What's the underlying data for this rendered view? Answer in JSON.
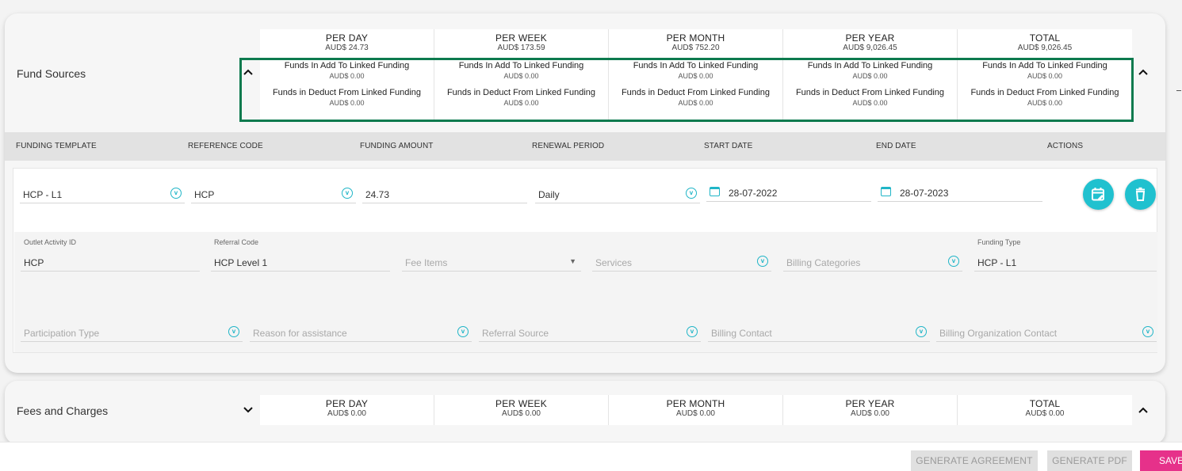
{
  "fund_sources": {
    "title": "Fund Sources",
    "summary": [
      {
        "head": "PER DAY",
        "amount": "AUD$ 24.73",
        "add_label": "Funds In Add To Linked Funding",
        "add_value": "AUD$ 0.00",
        "deduct_label": "Funds in Deduct From Linked Funding",
        "deduct_value": "AUD$ 0.00"
      },
      {
        "head": "PER WEEK",
        "amount": "AUD$ 173.59",
        "add_label": "Funds In Add To Linked Funding",
        "add_value": "AUD$ 0.00",
        "deduct_label": "Funds in Deduct From Linked Funding",
        "deduct_value": "AUD$ 0.00"
      },
      {
        "head": "PER MONTH",
        "amount": "AUD$ 752.20",
        "add_label": "Funds In Add To Linked Funding",
        "add_value": "AUD$ 0.00",
        "deduct_label": "Funds in Deduct From Linked Funding",
        "deduct_value": "AUD$ 0.00"
      },
      {
        "head": "PER YEAR",
        "amount": "AUD$ 9,026.45",
        "add_label": "Funds In Add To Linked Funding",
        "add_value": "AUD$ 0.00",
        "deduct_label": "Funds in Deduct From Linked Funding",
        "deduct_value": "AUD$ 0.00"
      },
      {
        "head": "TOTAL",
        "amount": "AUD$ 9,026.45",
        "add_label": "Funds In Add To Linked Funding",
        "add_value": "AUD$ 0.00",
        "deduct_label": "Funds in Deduct From Linked Funding",
        "deduct_value": "AUD$ 0.00"
      }
    ],
    "columns": [
      "FUNDING TEMPLATE",
      "REFERENCE CODE",
      "FUNDING AMOUNT",
      "RENEWAL PERIOD",
      "START DATE",
      "END DATE",
      "ACTIONS"
    ],
    "row": {
      "funding_template": "HCP - L1",
      "reference_code": "HCP",
      "funding_amount": "24.73",
      "renewal_period": "Daily",
      "start_date": "28-07-2022",
      "end_date": "28-07-2023"
    },
    "details": {
      "outlet_activity_label": "Outlet Activity ID",
      "outlet_activity_value": "HCP",
      "referral_code_label": "Referral Code",
      "referral_code_value": "HCP Level 1",
      "fee_items_placeholder": "Fee Items",
      "services_placeholder": "Services",
      "billing_categories_placeholder": "Billing Categories",
      "funding_type_label": "Funding Type",
      "funding_type_value": "HCP - L1",
      "participation_type_placeholder": "Participation Type",
      "reason_placeholder": "Reason for assistance",
      "referral_source_placeholder": "Referral Source",
      "billing_contact_placeholder": "Billing Contact",
      "billing_org_contact_placeholder": "Billing Organization Contact"
    }
  },
  "fees_and_charges": {
    "title": "Fees and Charges",
    "summary": [
      {
        "head": "PER DAY",
        "amount": "AUD$ 0.00"
      },
      {
        "head": "PER WEEK",
        "amount": "AUD$ 0.00"
      },
      {
        "head": "PER MONTH",
        "amount": "AUD$ 0.00"
      },
      {
        "head": "PER YEAR",
        "amount": "AUD$ 0.00"
      },
      {
        "head": "TOTAL",
        "amount": "AUD$ 0.00"
      }
    ]
  },
  "footer": {
    "generate_agreement": "GENERATE AGREEMENT",
    "generate_pdf": "GENERATE PDF",
    "save": "SAVE"
  },
  "icons": {
    "collapse": "chevron-up-icon",
    "expand": "chevron-down-icon",
    "select": "circle-chevron-down-icon",
    "calendar": "calendar-icon",
    "edit_calendar": "edit-calendar-icon",
    "delete": "trash-icon"
  },
  "colors": {
    "accent": "#20c1cf",
    "highlight_border": "#0d7a4e",
    "save": "#e6318a"
  }
}
